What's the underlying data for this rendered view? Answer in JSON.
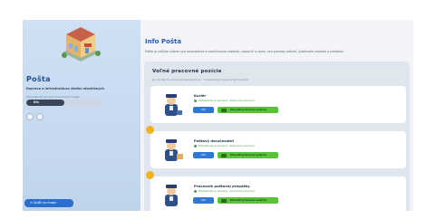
{
  "sidebar": {
    "title": "Pošta",
    "subtitle": "Doprava a infrastruktura všetkú staviebných",
    "vacancies_label": "Obsadenosť voľných pracovných miest",
    "progress": {
      "value": 0.5,
      "text": "0%"
    },
    "back_label": "< Späť na mapu"
  },
  "main": {
    "info_title": "Info Pošta",
    "info_desc": "Pošta je veľkým súbom pre rozosielanie a doručovanie zásielok, doporuč a správ, pre prevody peňazí, výdávanie známok a podobne.",
    "vacancies": {
      "title": "Voľné pracovné pozície",
      "subtitle": "Je v pošte 3 voľné pracovné pozície - 0 obsadených pracovných pozícií",
      "jobs": [
        {
          "name": "Kuriér",
          "requirement": "Požiadavka je splnená, dostupné pracovné",
          "info_label": "Info",
          "hire_label": "Obsadiť pracovnú pozíciu",
          "badge": false
        },
        {
          "name": "Poštový doručovateľ",
          "requirement": "Požiadavka je splnená, dostupné pracovné",
          "info_label": "Info",
          "hire_label": "Obsadiť pracovnú pozíciu",
          "badge": true
        },
        {
          "name": "Pracovník poštovej prepážky",
          "requirement": "Požiadavka je splnená, dostupné pracovné",
          "info_label": "Info",
          "hire_label": "Obsadiť pracovnú pozíciu",
          "badge": true
        }
      ]
    }
  },
  "colors": {
    "accent": "#2a5db0",
    "button_blue": "#2e77d4",
    "button_green": "#58c23a"
  }
}
